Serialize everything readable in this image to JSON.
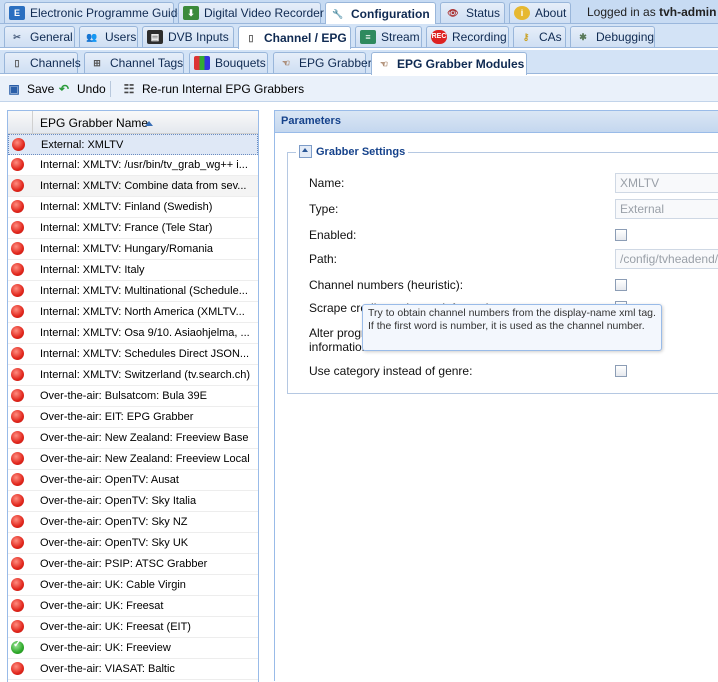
{
  "top_tabs": [
    {
      "label": "Electronic Programme Guide",
      "icon": "epg-icon"
    },
    {
      "label": "Digital Video Recorder",
      "icon": "dvr-icon"
    },
    {
      "label": "Configuration",
      "icon": "wrench-icon"
    },
    {
      "label": "Status",
      "icon": "eye-icon"
    },
    {
      "label": "About",
      "icon": "info-icon"
    }
  ],
  "login": {
    "prefix": "Logged in as",
    "user": "tvh-admin"
  },
  "config_tabs": [
    {
      "label": "General",
      "icon": "tools-icon"
    },
    {
      "label": "Users",
      "icon": "users-icon"
    },
    {
      "label": "DVB Inputs",
      "icon": "dvb-icon"
    },
    {
      "label": "Channel / EPG",
      "icon": "channel-icon"
    },
    {
      "label": "Stream",
      "icon": "stream-icon"
    },
    {
      "label": "Recording",
      "icon": "rec-icon"
    },
    {
      "label": "CAs",
      "icon": "key-icon"
    },
    {
      "label": "Debugging",
      "icon": "bug-icon"
    }
  ],
  "sub_tabs": [
    {
      "label": "Channels",
      "icon": "phone-icon"
    },
    {
      "label": "Channel Tags",
      "icon": "tags-icon"
    },
    {
      "label": "Bouquets",
      "icon": "bouquet-icon"
    },
    {
      "label": "EPG Grabber",
      "icon": "hand-icon"
    },
    {
      "label": "EPG Grabber Modules",
      "icon": "hand-icon"
    }
  ],
  "toolbar": {
    "save": "Save",
    "undo": "Undo",
    "rerun": "Re-run Internal EPG Grabbers"
  },
  "grid": {
    "column": "EPG Grabber Name",
    "rows": [
      {
        "name": "External: XMLTV",
        "enabled": false
      },
      {
        "name": "Internal: XMLTV: /usr/bin/tv_grab_wg++ i...",
        "enabled": false
      },
      {
        "name": "Internal: XMLTV: Combine data from sev...",
        "enabled": false
      },
      {
        "name": "Internal: XMLTV: Finland (Swedish)",
        "enabled": false
      },
      {
        "name": "Internal: XMLTV: France (Tele Star)",
        "enabled": false
      },
      {
        "name": "Internal: XMLTV: Hungary/Romania",
        "enabled": false
      },
      {
        "name": "Internal: XMLTV: Italy",
        "enabled": false
      },
      {
        "name": "Internal: XMLTV: Multinational (Schedule...",
        "enabled": false
      },
      {
        "name": "Internal: XMLTV: North America (XMLTV...",
        "enabled": false
      },
      {
        "name": "Internal: XMLTV: Osa 9/10. Asiaohjelma, ...",
        "enabled": false
      },
      {
        "name": "Internal: XMLTV: Schedules Direct JSON...",
        "enabled": false
      },
      {
        "name": "Internal: XMLTV: Switzerland (tv.search.ch)",
        "enabled": false
      },
      {
        "name": "Over-the-air: Bulsatcom: Bula 39E",
        "enabled": false
      },
      {
        "name": "Over-the-air: EIT: EPG Grabber",
        "enabled": false
      },
      {
        "name": "Over-the-air: New Zealand: Freeview Base",
        "enabled": false
      },
      {
        "name": "Over-the-air: New Zealand: Freeview Local",
        "enabled": false
      },
      {
        "name": "Over-the-air: OpenTV: Ausat",
        "enabled": false
      },
      {
        "name": "Over-the-air: OpenTV: Sky Italia",
        "enabled": false
      },
      {
        "name": "Over-the-air: OpenTV: Sky NZ",
        "enabled": false
      },
      {
        "name": "Over-the-air: OpenTV: Sky UK",
        "enabled": false
      },
      {
        "name": "Over-the-air: PSIP: ATSC Grabber",
        "enabled": false
      },
      {
        "name": "Over-the-air: UK: Cable Virgin",
        "enabled": false
      },
      {
        "name": "Over-the-air: UK: Freesat",
        "enabled": false
      },
      {
        "name": "Over-the-air: UK: Freesat (EIT)",
        "enabled": false
      },
      {
        "name": "Over-the-air: UK: Freeview",
        "enabled": true
      },
      {
        "name": "Over-the-air: VIASAT: Baltic",
        "enabled": false
      }
    ]
  },
  "params": {
    "title": "Parameters",
    "section": "Grabber Settings",
    "name_label": "Name:",
    "name_value": "XMLTV",
    "type_label": "Type:",
    "type_value": "External",
    "enabled_label": "Enabled:",
    "path_label": "Path:",
    "path_value": "/config/tvheadend/ep",
    "chnum_label": "Channel numbers (heuristic):",
    "scrape_label": "Scrape credits and extra information:",
    "alter_label1": "Alter program",
    "alter_label2": "information:",
    "category_label": "Use category instead of genre:"
  },
  "tooltip": "Try to obtain channel numbers from the display-name xml tag. If the first word is number, it is used as the channel number."
}
